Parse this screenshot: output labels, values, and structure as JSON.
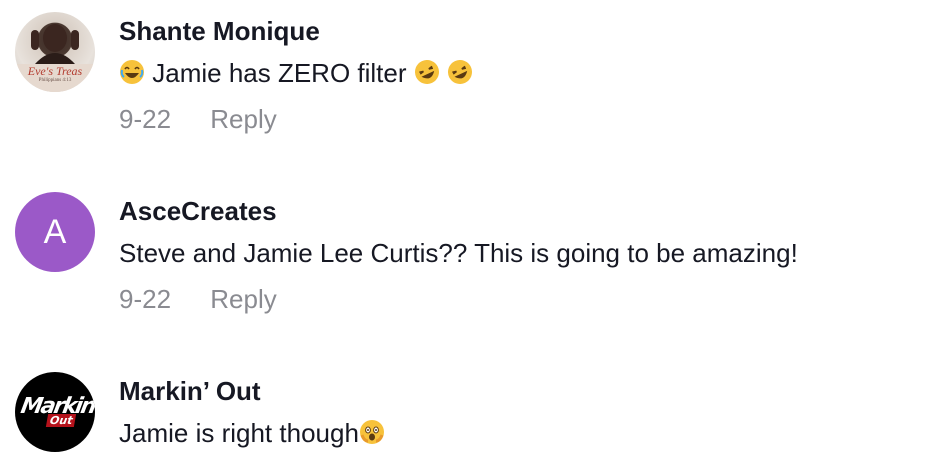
{
  "comments": [
    {
      "username": "Shante Monique",
      "avatar_icon": "profile-photo",
      "avatar_banner": "Eve's Treas",
      "avatar_banner_sub": "Philippians 4:13",
      "text": "Jamie has ZERO filter ",
      "date": "9-22",
      "reply_label": "Reply"
    },
    {
      "username": "AsceCreates",
      "avatar_letter": "A",
      "avatar_color": "#9b59c8",
      "text": "Steve and Jamie Lee Curtis?? This is going to be amazing!",
      "date": "9-22",
      "reply_label": "Reply"
    },
    {
      "username": "Markin’ Out",
      "avatar_logo_top": "Markin'",
      "avatar_logo_bottom": "Out",
      "text": "Jamie is right though"
    }
  ],
  "colors": {
    "text": "#161823",
    "muted": "#8a8b91",
    "emoji_yellow": "#f7c23b"
  }
}
